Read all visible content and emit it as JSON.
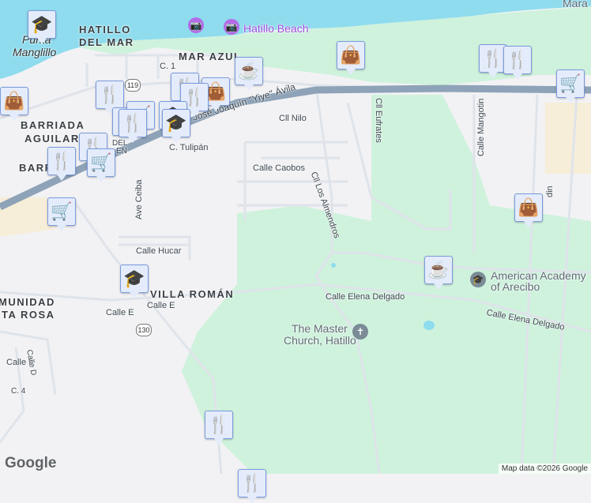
{
  "labels": {
    "hatillo_del_mar_1": "HATILLO",
    "hatillo_del_mar_2": "DEL MAR",
    "punta_manglillo_1": "Punta",
    "punta_manglillo_2": "Manglillo",
    "mar_azul": "MAR AZUL",
    "hatillo_beach": "Hatillo Beach",
    "mara": "Mara",
    "c1": "C. 1",
    "highway": "Ave. José Joaquín \"Yiye\" Ávila",
    "cll_nilo": "Cll Nilo",
    "cll_eufrates": "Cll Eufrates",
    "calle_mangotin": "Calle Mangotin",
    "barriada_aguilar_1": "BARRIADA",
    "barriada_aguilar_2": "AGUILAR",
    "barr": "BARR",
    "c_tulipan": "C. Tulipán",
    "calle_caobos": "Calle Caobos",
    "cll_los_almendros": "Cll Los Almendros",
    "ave_ceiba": "Ave Ceiba",
    "calle_hucar": "Calle Hucar",
    "villa_roman": "VILLA ROMÁN",
    "calle_e_1": "Calle E",
    "calle_e_2": "Calle E",
    "calle_elena_delgado_1": "Calle Elena Delgado",
    "calle_elena_delgado_2": "Calle Elena Delgado",
    "american_academy_1": "American Academy",
    "american_academy_2": "of Arecibo",
    "master_church_1": "The Master",
    "master_church_2": "Church, Hatillo",
    "munidad": "MUNIDAD",
    "ta_rosa": "TA ROSA",
    "calle_i": "Calle I",
    "calle_d": "Calle D",
    "c4": "C. 4",
    "route_119": "119",
    "route_130": "130",
    "del": "DEL",
    "en": "EN",
    "dinr": "din"
  },
  "google_logo": "Google",
  "attribution": "Map data ©2026 Google",
  "markers": [
    {
      "type": "school",
      "icon": "🎓"
    },
    {
      "type": "shopping",
      "icon": "👜"
    },
    {
      "type": "restaurant",
      "icon": "🍴"
    },
    {
      "type": "coffee",
      "icon": "☕"
    },
    {
      "type": "shopping",
      "icon": "👜"
    },
    {
      "type": "restaurant",
      "icon": "🍴"
    },
    {
      "type": "restaurant",
      "icon": "🍴"
    },
    {
      "type": "grocery",
      "icon": "🛒"
    },
    {
      "type": "restaurant",
      "icon": "🍴"
    },
    {
      "type": "shopping",
      "icon": "👜"
    },
    {
      "type": "restaurant",
      "icon": "🍴"
    },
    {
      "type": "restaurant",
      "icon": "🍴"
    },
    {
      "type": "grocery",
      "icon": "🛒"
    },
    {
      "type": "restaurant",
      "icon": "🍴"
    },
    {
      "type": "school",
      "icon": "🎓"
    },
    {
      "type": "school",
      "icon": "🎓"
    },
    {
      "type": "restaurant",
      "icon": "🍴"
    },
    {
      "type": "restaurant",
      "icon": "🍴"
    },
    {
      "type": "grocery",
      "icon": "🛒"
    },
    {
      "type": "grocery",
      "icon": "🛒"
    },
    {
      "type": "shopping",
      "icon": "👜"
    },
    {
      "type": "coffee",
      "icon": "☕"
    },
    {
      "type": "school",
      "icon": "🎓"
    },
    {
      "type": "restaurant",
      "icon": "🍴"
    },
    {
      "type": "restaurant",
      "icon": "🍴"
    }
  ],
  "colors": {
    "water": "#8edcee",
    "park": "#cff2dd",
    "land": "#f2f2f4",
    "highway": "#8ea3b8",
    "marker_icon": "#0c4468"
  }
}
